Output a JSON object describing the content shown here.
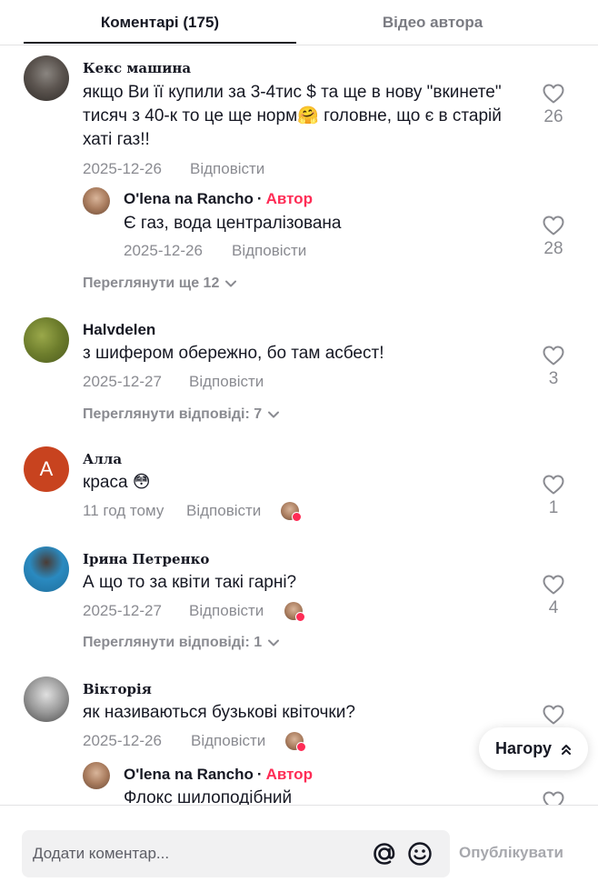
{
  "tabs": {
    "comments_label": "Коментарі (175)",
    "author_videos_label": "Відео автора"
  },
  "reply_label": "Відповісти",
  "author_label": "Автор",
  "comments": [
    {
      "username": "Кекс машина",
      "text": "якщо Ви її купили за 3-4тис $ та ще в нову \"вкинете\" тисяч з 40-к то це ще норм🤗 головне, що є в старій хаті газ!!",
      "date": "2025-12-26",
      "likes": "26",
      "replies": [
        {
          "username": "O'lena na Rancho",
          "text": "Є газ, вода централізована",
          "date": "2025-12-26",
          "likes": "28"
        }
      ],
      "more_label": "Переглянути ще 12"
    },
    {
      "username": "Halvdelen",
      "text": "з шифером обережно, бо там асбест!",
      "date": "2025-12-27",
      "likes": "3",
      "more_label": "Переглянути відповіді: 7"
    },
    {
      "username": "Алла",
      "avatar_letter": "A",
      "text": "краса 😳",
      "date": "11 год тому",
      "likes": "1"
    },
    {
      "username": "Ірина Петренко",
      "text": "А що то за квіти такі гарні?",
      "date": "2025-12-27",
      "likes": "4",
      "more_label": "Переглянути відповіді: 1"
    },
    {
      "username": "Вікторія",
      "text": "як називаються бузькові квіточки?",
      "date": "2025-12-26",
      "replies": [
        {
          "username": "O'lena na Rancho",
          "text": "Флокс шилоподібний"
        }
      ]
    }
  ],
  "back_to_top_label": "Нагору",
  "footer": {
    "input_placeholder": "Додати коментар...",
    "publish_label": "Опублікувати"
  },
  "colors": {
    "accent": "#fe2c55",
    "text": "#161823",
    "muted": "#8a8b91",
    "avatar_alla": "#c8431f"
  }
}
